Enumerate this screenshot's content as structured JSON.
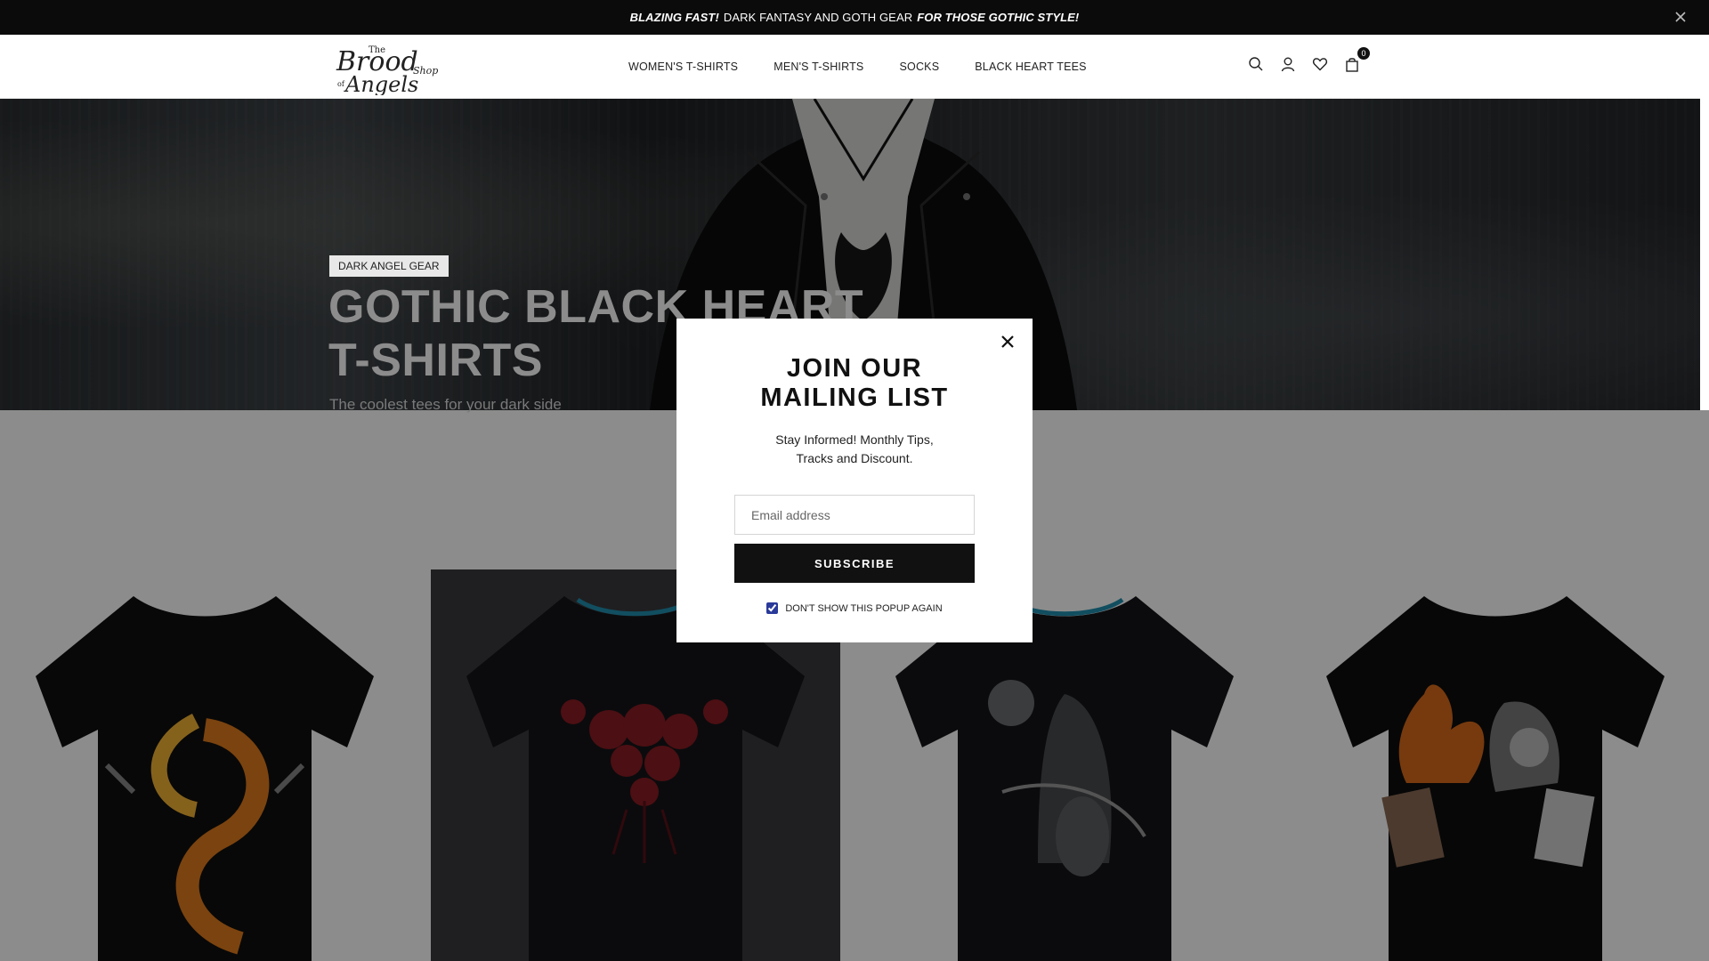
{
  "announcement": {
    "lead": "BLAZING FAST!",
    "middle": "DARK FANTASY AND GOTH GEAR",
    "trail": "FOR THOSE GOTHIC STYLE!"
  },
  "header": {
    "logo_text": "The Brood of Angels Shop",
    "nav": [
      "WOMEN'S T-SHIRTS",
      "MEN'S T-SHIRTS",
      "SOCKS",
      "BLACK HEART TEES"
    ],
    "cart_count": "0"
  },
  "hero": {
    "tag": "DARK ANGEL GEAR",
    "title_line1": "GOTHIC BLACK HEART",
    "title_line2": "T-SHIRTS",
    "subtitle": "The coolest tees for your dark side"
  },
  "popup": {
    "title_line1": "JOIN OUR",
    "title_line2": "MAILING LIST",
    "text": "Stay Informed! Monthly Tips, Tracks and Discount.",
    "email_placeholder": "Email address",
    "subscribe_label": "SUBSCRIBE",
    "dont_show_label": "DON'T SHOW THIS POPUP AGAIN",
    "dont_show_checked": true
  },
  "colors": {
    "announce_bg": "#0b0b0b",
    "button_bg": "#111111",
    "checkbox": "#2a3a9a"
  }
}
